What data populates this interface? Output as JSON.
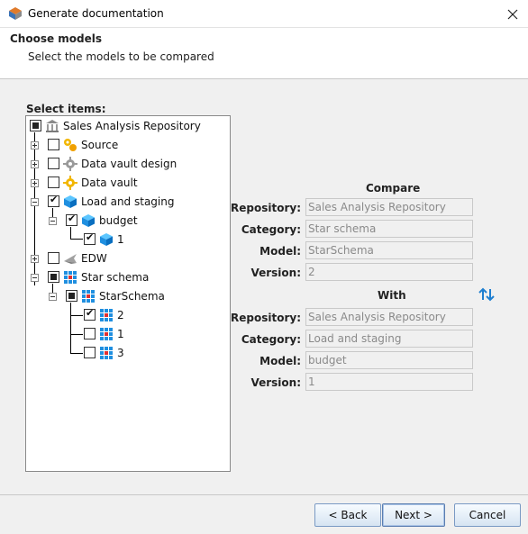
{
  "window": {
    "title": "Generate documentation"
  },
  "header": {
    "title": "Choose models",
    "subtitle": "Select the models to be compared"
  },
  "tree": {
    "label": "Select items:",
    "nodes": [
      {
        "label": "Sales Analysis Repository",
        "state": "partial",
        "icon": "repository-icon"
      },
      {
        "label": "Source",
        "state": "unchecked",
        "icon": "source-icon"
      },
      {
        "label": "Data vault design",
        "state": "unchecked",
        "icon": "data-vault-design-icon"
      },
      {
        "label": "Data vault",
        "state": "unchecked",
        "icon": "data-vault-icon"
      },
      {
        "label": "Load and staging",
        "state": "checked",
        "icon": "load-staging-icon"
      },
      {
        "label": "budget",
        "state": "checked",
        "icon": "cube-icon"
      },
      {
        "label": "1",
        "state": "checked",
        "icon": "cube-icon"
      },
      {
        "label": "EDW",
        "state": "unchecked",
        "icon": "edw-icon"
      },
      {
        "label": "Star schema",
        "state": "partial",
        "icon": "star-schema-icon"
      },
      {
        "label": "StarSchema",
        "state": "partial",
        "icon": "star-schema-icon"
      },
      {
        "label": "2",
        "state": "checked",
        "icon": "star-schema-icon"
      },
      {
        "label": "1",
        "state": "unchecked",
        "icon": "star-schema-icon"
      },
      {
        "label": "3",
        "state": "unchecked",
        "icon": "star-schema-icon"
      }
    ]
  },
  "compare": {
    "heading": "Compare",
    "repository_label": "Repository:",
    "repository": "Sales Analysis Repository",
    "category_label": "Category:",
    "category": "Star schema",
    "model_label": "Model:",
    "model": "StarSchema",
    "version_label": "Version:",
    "version": "2"
  },
  "with": {
    "heading": "With",
    "repository_label": "Repository:",
    "repository": "Sales Analysis Repository",
    "category_label": "Category:",
    "category": "Load and staging",
    "model_label": "Model:",
    "model": "budget",
    "version_label": "Version:",
    "version": "1"
  },
  "buttons": {
    "back": "< Back",
    "next": "Next >",
    "cancel": "Cancel"
  }
}
